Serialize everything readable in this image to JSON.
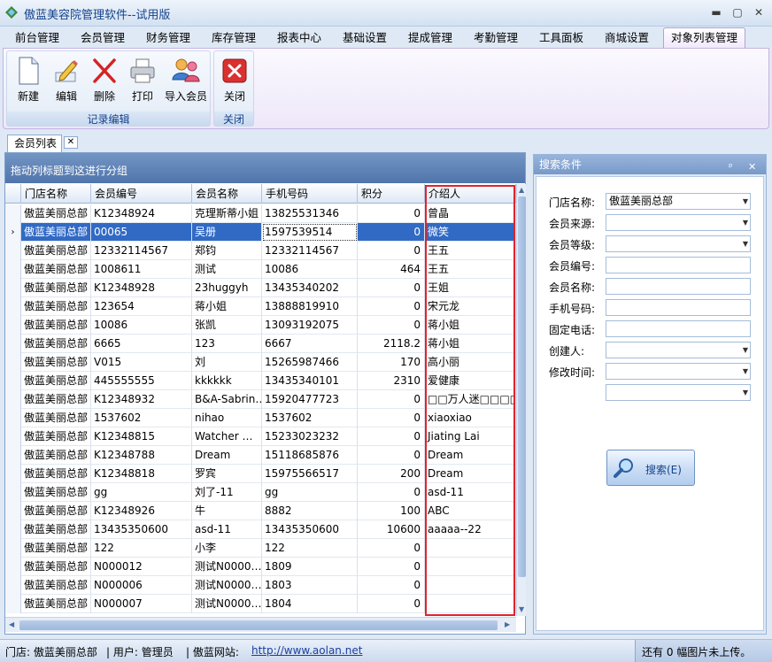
{
  "window": {
    "title": "傲蓝美容院管理软件--试用版",
    "min_symbol": "▬",
    "max_symbol": "▢",
    "close_symbol": "✕"
  },
  "menu": [
    "前台管理",
    "会员管理",
    "财务管理",
    "库存管理",
    "报表中心",
    "基础设置",
    "提成管理",
    "考勤管理",
    "工具面板",
    "商城设置",
    "对象列表管理"
  ],
  "ribbon": {
    "group1": {
      "caption": "记录编辑",
      "buttons": [
        "新建",
        "编辑",
        "删除",
        "打印",
        "导入会员"
      ]
    },
    "group2": {
      "caption": "关闭",
      "buttons": [
        "关闭"
      ]
    }
  },
  "doc_tab": {
    "label": "会员列表",
    "close_symbol": "✕"
  },
  "grid": {
    "group_hint": "拖动列标题到这进行分组",
    "columns": [
      "门店名称",
      "会员编号",
      "会员名称",
      "手机号码",
      "积分",
      "介绍人"
    ],
    "selected_row_marker": "›",
    "rows": [
      [
        "傲蓝美丽总部",
        "K12348924",
        "克理斯蒂小姐",
        "13825531346",
        "0",
        "曾晶"
      ],
      [
        "傲蓝美丽总部",
        "00065",
        "吴册",
        "1597539514",
        "0",
        "微笑"
      ],
      [
        "傲蓝美丽总部",
        "12332114567",
        "郑钧",
        "12332114567",
        "0",
        "王五"
      ],
      [
        "傲蓝美丽总部",
        "1008611",
        "测试",
        "10086",
        "464",
        "王五"
      ],
      [
        "傲蓝美丽总部",
        "K12348928",
        "23huggyh",
        "13435340202",
        "0",
        "王姐"
      ],
      [
        "傲蓝美丽总部",
        "123654",
        "蒋小姐",
        "13888819910",
        "0",
        "宋元龙"
      ],
      [
        "傲蓝美丽总部",
        "10086",
        "张凯",
        "13093192075",
        "0",
        "蒋小姐"
      ],
      [
        "傲蓝美丽总部",
        "6665",
        "123",
        "6667",
        "2118.2",
        "蒋小姐"
      ],
      [
        "傲蓝美丽总部",
        "V015",
        "刘",
        "15265987466",
        "170",
        "高小丽"
      ],
      [
        "傲蓝美丽总部",
        "445555555",
        "kkkkkk",
        "13435340101",
        "2310",
        "爱健康"
      ],
      [
        "傲蓝美丽总部",
        "K12348932",
        "B&A-Sabrin…",
        "15920477723",
        "0",
        "□□万人迷□□□□"
      ],
      [
        "傲蓝美丽总部",
        "1537602",
        "nihao",
        "1537602",
        "0",
        "xiaoxiao"
      ],
      [
        "傲蓝美丽总部",
        "K12348815",
        "Watcher …",
        "15233023232",
        "0",
        "Jiating Lai"
      ],
      [
        "傲蓝美丽总部",
        "K12348788",
        "Dream",
        "15118685876",
        "0",
        "Dream"
      ],
      [
        "傲蓝美丽总部",
        "K12348818",
        "罗宾",
        "15975566517",
        "200",
        "Dream"
      ],
      [
        "傲蓝美丽总部",
        "gg",
        "刘了-11",
        "gg",
        "0",
        "asd-11"
      ],
      [
        "傲蓝美丽总部",
        "K12348926",
        "牛",
        "8882",
        "100",
        "ABC"
      ],
      [
        "傲蓝美丽总部",
        "13435350600",
        "asd-11",
        "13435350600",
        "10600",
        "aaaaa--22"
      ],
      [
        "傲蓝美丽总部",
        "122",
        "小李",
        "122",
        "0",
        ""
      ],
      [
        "傲蓝美丽总部",
        "N000012",
        "测试N0000…",
        "1809",
        "0",
        ""
      ],
      [
        "傲蓝美丽总部",
        "N000006",
        "测试N0000…",
        "1803",
        "0",
        ""
      ],
      [
        "傲蓝美丽总部",
        "N000007",
        "测试N0000…",
        "1804",
        "0",
        ""
      ]
    ]
  },
  "search": {
    "title": "搜索条件",
    "pin_symbol": "ᵖ",
    "close_symbol": "✕",
    "labels": {
      "store": "门店名称:",
      "source": "会员来源:",
      "level": "会员等级:",
      "code": "会员编号:",
      "name": "会员名称:",
      "mobile": "手机号码:",
      "phone": "固定电话:",
      "creator": "创建人:",
      "modified": "修改时间:"
    },
    "store_value": "傲蓝美丽总部",
    "button_label": "搜索(E)"
  },
  "status": {
    "store": "门店: 傲蓝美丽总部",
    "user": "| 用户: 管理员",
    "site_label": "| 傲蓝网站:",
    "site_url": "http://www.aolan.net",
    "upload": "还有 0 幅图片未上传。"
  },
  "colors": {
    "accent": "#316ac5",
    "highlight_box": "#e0242c",
    "header": "#15428b"
  }
}
